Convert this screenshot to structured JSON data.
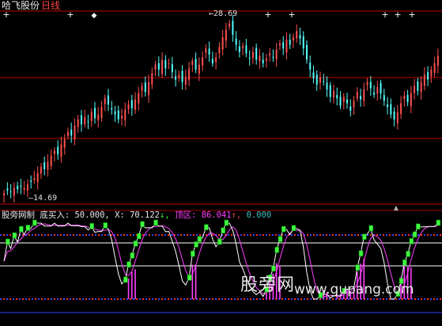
{
  "header": {
    "title": "哈飞股份",
    "period": "日线"
  },
  "price_labels": {
    "high": "28.69",
    "low": "14.69"
  },
  "indicator": {
    "name": "股旁网制",
    "buy_label": "底买入:",
    "buy_value": "50.000,",
    "x_label": "X:",
    "x_value": "70.122",
    "x_arrow": "↓,",
    "top_label": "顶区:",
    "top_value": "86.041",
    "top_arrow": "↑,",
    "last_value": "0.000"
  },
  "watermark": {
    "cn": "股旁网",
    "url": "www.gupang.com"
  },
  "colors": {
    "background": "#000000",
    "up_candle": "#ff5050",
    "down_candle": "#54ffff",
    "ma_line": "#e8e8e8",
    "signal_green": "#40ff40",
    "magenta": "#ff40ff",
    "ref_line_red": "#c00000"
  },
  "chart_data": [
    {
      "type": "candlestick",
      "title": "哈飞股份 日线",
      "high_label": 28.69,
      "low_label": 14.69,
      "ylim": [
        14.0,
        29.5
      ],
      "closes": [
        14.9,
        15.1,
        15.0,
        15.3,
        15.2,
        15.4,
        15.3,
        15.6,
        15.8,
        16.1,
        16.5,
        17.0,
        16.8,
        17.4,
        17.9,
        18.3,
        18.0,
        18.8,
        19.2,
        19.8,
        19.5,
        20.3,
        20.8,
        20.4,
        21.0,
        20.6,
        21.4,
        20.9,
        21.2,
        21.8,
        22.5,
        22.0,
        21.6,
        21.2,
        20.8,
        21.1,
        21.6,
        22.0,
        21.7,
        22.4,
        22.9,
        23.5,
        23.0,
        23.8,
        24.5,
        25.2,
        24.8,
        25.6,
        24.9,
        25.3,
        24.6,
        24.0,
        24.4,
        23.8,
        24.2,
        24.9,
        25.5,
        24.8,
        25.2,
        25.8,
        26.5,
        26.0,
        25.3,
        25.8,
        26.6,
        27.4,
        28.0,
        28.5,
        27.6,
        26.8,
        26.2,
        26.7,
        26.1,
        25.7,
        26.2,
        25.6,
        25.9,
        25.3,
        25.7,
        26.1,
        25.8,
        26.4,
        26.9,
        26.5,
        27.2,
        26.8,
        27.4,
        27.9,
        27.3,
        26.5,
        25.6,
        24.8,
        24.1,
        23.6,
        24.2,
        23.8,
        23.2,
        22.6,
        23.1,
        22.5,
        21.9,
        22.6,
        22.1,
        21.5,
        22.3,
        23.0,
        22.4,
        23.2,
        23.8,
        23.3,
        22.8,
        23.4,
        22.9,
        22.3,
        21.8,
        21.2,
        20.8,
        21.4,
        22.1,
        22.7,
        22.2,
        22.9,
        23.5,
        23.1,
        23.8,
        24.4,
        24.0,
        24.8,
        25.3,
        25.9
      ]
    },
    {
      "type": "line",
      "title": "股旁网制",
      "levels": {
        "buy": 50.0,
        "top": 86.041
      },
      "x_value": 70.122,
      "ylim": [
        0,
        100
      ]
    }
  ]
}
